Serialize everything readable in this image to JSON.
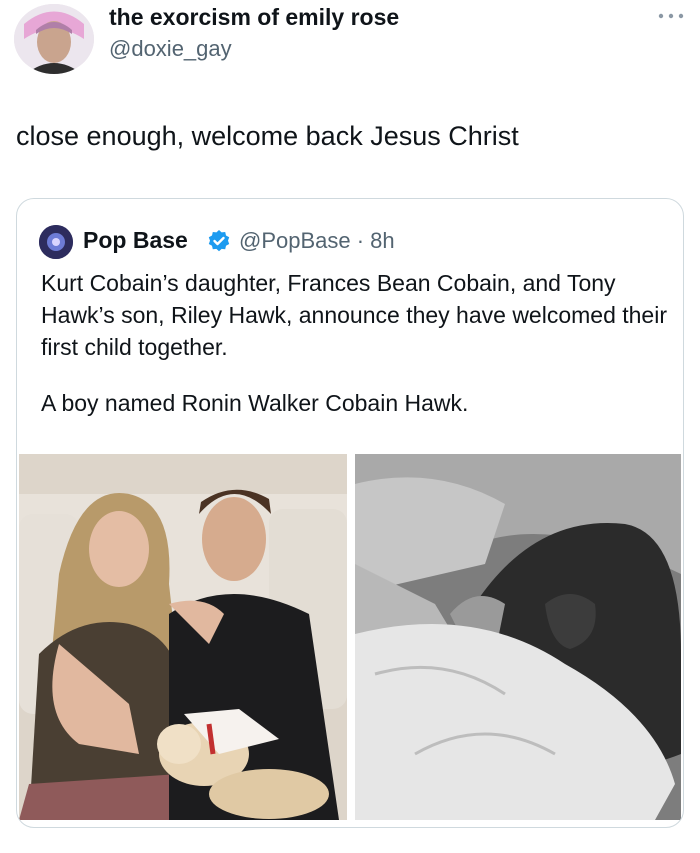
{
  "tweet": {
    "author_name": "the exorcism of emily rose",
    "author_handle": "@doxie_gay",
    "text": "close enough, welcome back Jesus Christ",
    "more_icon": "ellipsis-icon"
  },
  "quote": {
    "author_name": "Pop Base",
    "author_handle": "@PopBase · 8h",
    "verified_color": "#1d9bf0",
    "paragraph_1": "Kurt Cobain’s daughter, Frances Bean Cobain, and Tony Hawk’s son, Riley Hawk, announce they have welcomed their first child together.",
    "paragraph_2": "A boy named Ronin Walker Cobain Hawk."
  },
  "colors": {
    "text": "#0f1419",
    "secondary": "#536471",
    "border": "#cfd9de"
  }
}
